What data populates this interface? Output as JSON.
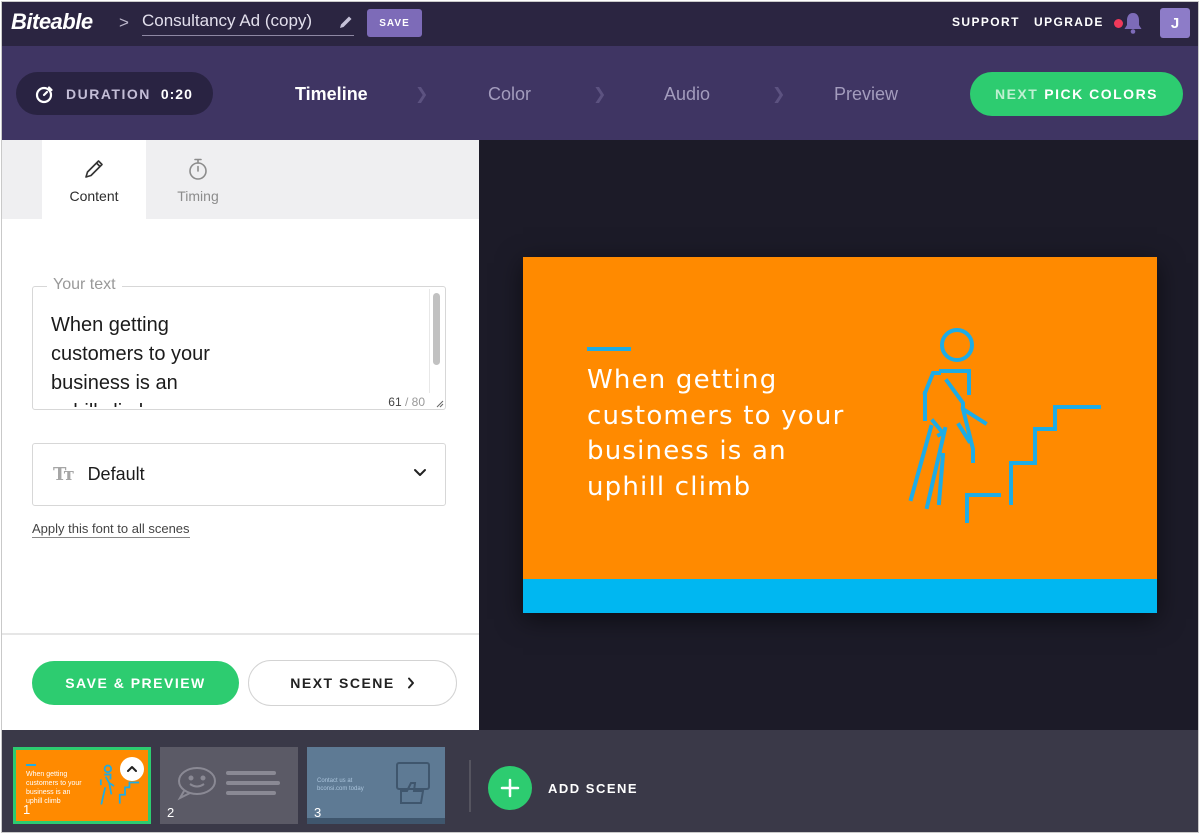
{
  "header": {
    "logo": "Biteable",
    "breadcrumb_separator": ">",
    "project_name": "Consultancy Ad (copy)",
    "save_label": "SAVE",
    "support_label": "SUPPORT",
    "upgrade_label": "UPGRADE",
    "avatar_initial": "J",
    "accent_color": "#7d6bb8",
    "notification_dot_color": "#f0395a"
  },
  "stepbar": {
    "duration_label": "DURATION",
    "duration_value": "0:20",
    "steps": [
      {
        "label": "Timeline",
        "active": true
      },
      {
        "label": "Color",
        "active": false
      },
      {
        "label": "Audio",
        "active": false
      },
      {
        "label": "Preview",
        "active": false
      }
    ],
    "next_prefix": "NEXT",
    "next_label": "PICK COLORS",
    "button_color": "#2dcc70"
  },
  "editor": {
    "tabs": [
      {
        "label": "Content",
        "icon": "pencil-icon",
        "active": true
      },
      {
        "label": "Timing",
        "icon": "stopwatch-icon",
        "active": false
      }
    ],
    "text_field": {
      "legend": "Your text",
      "value": "When getting\ncustomers to your\nbusiness is an\nuphill climb",
      "char_count": "61",
      "char_max": "/ 80"
    },
    "font_select": {
      "icon": "Tт",
      "value": "Default"
    },
    "apply_link": "Apply this font to all scenes",
    "save_preview_label": "SAVE & PREVIEW",
    "next_scene_label": "NEXT SCENE"
  },
  "preview": {
    "slide_text": "When getting\ncustomers to your\nbusiness is an\nuphill climb",
    "background_color": "#ff8a00",
    "accent_color": "#1dace6",
    "band_color": "#00b7f1",
    "illustration": "climbing-stairs-icon"
  },
  "scenes": {
    "items": [
      {
        "number": "1",
        "text": "When getting\ncustomers to your\nbusiness is an\nuphill climb",
        "selected": true
      },
      {
        "number": "2",
        "text": "",
        "selected": false
      },
      {
        "number": "3",
        "text": "Contact us at\nbconsi.com today",
        "selected": false
      }
    ],
    "add_label": "ADD SCENE"
  }
}
